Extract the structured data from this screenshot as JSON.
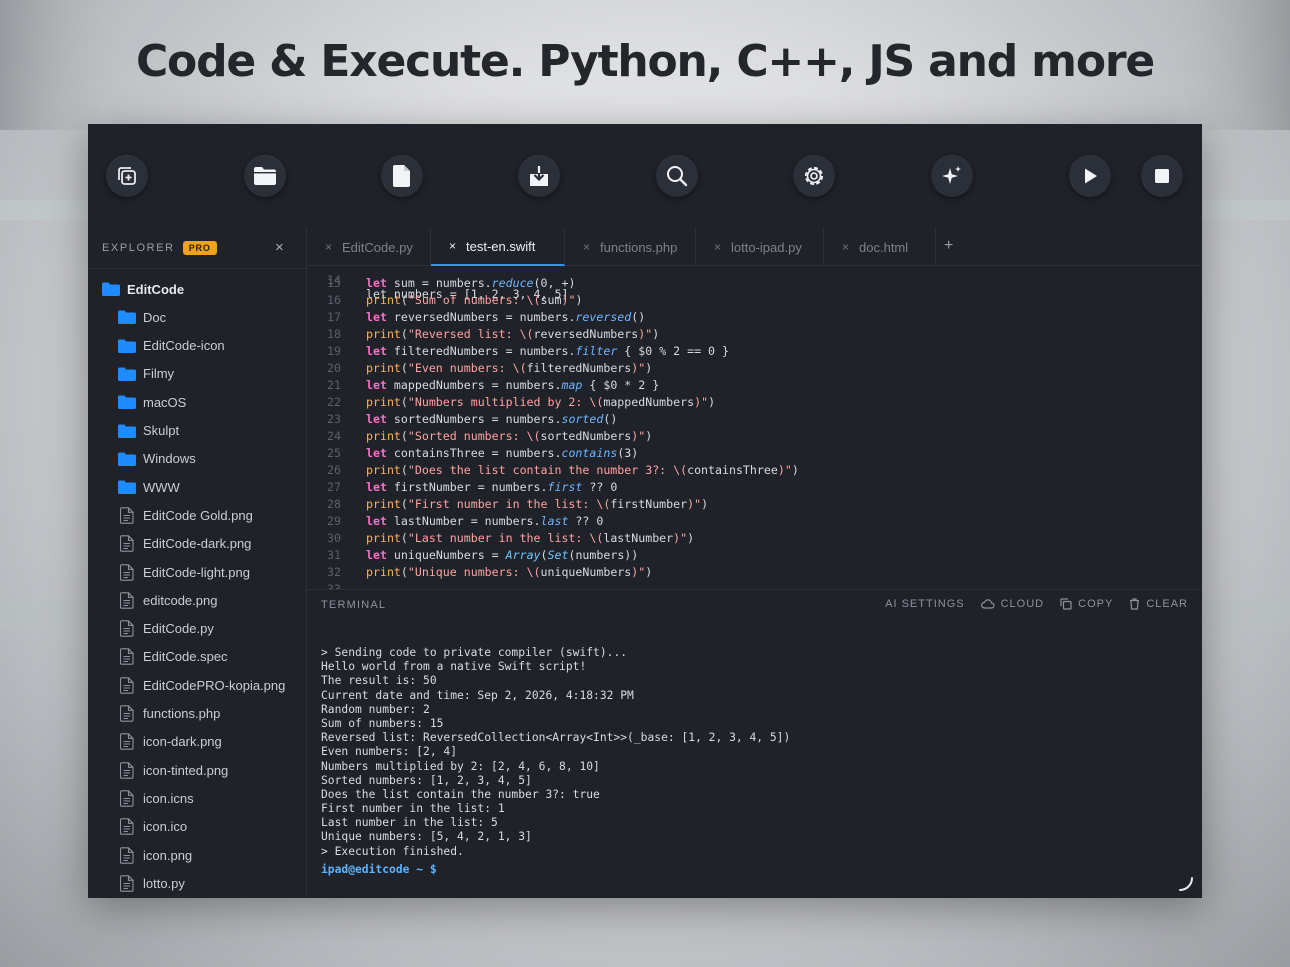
{
  "headline": "Code & Execute. Python, C++, JS and more",
  "toolbar": {
    "buttons": [
      {
        "name": "new-window-icon"
      },
      {
        "name": "folder-icon"
      },
      {
        "name": "new-file-icon"
      },
      {
        "name": "download-icon"
      },
      {
        "name": "search-icon"
      },
      {
        "name": "gear-icon"
      },
      {
        "name": "sparkles-icon"
      },
      {
        "name": "play-icon"
      },
      {
        "name": "stop-icon"
      }
    ]
  },
  "explorer": {
    "title": "EXPLORER",
    "badge": "PRO",
    "close": "×",
    "root": "EditCode",
    "folders": [
      "Doc",
      "EditCode-icon",
      "Filmy",
      "macOS",
      "Skulpt",
      "Windows",
      "WWW"
    ],
    "files": [
      "EditCode Gold.png",
      "EditCode-dark.png",
      "EditCode-light.png",
      "editcode.png",
      "EditCode.py",
      "EditCode.spec",
      "EditCodePRO-kopia.png",
      "functions.php",
      "icon-dark.png",
      "icon-tinted.png",
      "icon.icns",
      "icon.ico",
      "icon.png",
      "lotto.py"
    ]
  },
  "tabs": [
    {
      "label": "EditCode.py",
      "close": "×"
    },
    {
      "label": "test-en.swift",
      "close": "×",
      "active": true
    },
    {
      "label": "functions.php",
      "close": "×"
    },
    {
      "label": "lotto-ipad.py",
      "close": "×"
    },
    {
      "label": "doc.html",
      "close": "×"
    }
  ],
  "tab_add": "+",
  "editor": {
    "partial_top": "let numbers = [1, 2, 3, 4, 5]",
    "partial_bottom_number": "33",
    "lines": [
      {
        "n": "15",
        "code": "let sum = numbers.reduce(0, +)"
      },
      {
        "n": "16",
        "code": "print(\"Sum of numbers: \\(sum)\")"
      },
      {
        "n": "17",
        "code": "let reversedNumbers = numbers.reversed()"
      },
      {
        "n": "18",
        "code": "print(\"Reversed list: \\(reversedNumbers)\")"
      },
      {
        "n": "19",
        "code": "let filteredNumbers = numbers.filter { $0 % 2 == 0 }"
      },
      {
        "n": "20",
        "code": "print(\"Even numbers: \\(filteredNumbers)\")"
      },
      {
        "n": "21",
        "code": "let mappedNumbers = numbers.map { $0 * 2 }"
      },
      {
        "n": "22",
        "code": "print(\"Numbers multiplied by 2: \\(mappedNumbers)\")"
      },
      {
        "n": "23",
        "code": "let sortedNumbers = numbers.sorted()"
      },
      {
        "n": "24",
        "code": "print(\"Sorted numbers: \\(sortedNumbers)\")"
      },
      {
        "n": "25",
        "code": "let containsThree = numbers.contains(3)"
      },
      {
        "n": "26",
        "code": "print(\"Does the list contain the number 3?: \\(containsThree)\")"
      },
      {
        "n": "27",
        "code": "let firstNumber = numbers.first ?? 0"
      },
      {
        "n": "28",
        "code": "print(\"First number in the list: \\(firstNumber)\")"
      },
      {
        "n": "29",
        "code": "let lastNumber = numbers.last ?? 0"
      },
      {
        "n": "30",
        "code": "print(\"Last number in the list: \\(lastNumber)\")"
      },
      {
        "n": "31",
        "code": "let uniqueNumbers = Array(Set(numbers))"
      },
      {
        "n": "32",
        "code": "print(\"Unique numbers: \\(uniqueNumbers)\")"
      }
    ]
  },
  "terminal": {
    "title": "TERMINAL",
    "actions": {
      "ai_settings": "AI SETTINGS",
      "cloud": "CLOUD",
      "copy": "COPY",
      "clear": "CLEAR"
    },
    "output": [
      "> Sending code to private compiler (swift)...",
      "Hello world from a native Swift script!",
      "The result is: 50",
      "Current date and time: Sep 2, 2026, 4:18:32 PM",
      "Random number: 2",
      "Sum of numbers: 15",
      "Reversed list: ReversedCollection<Array<Int>>(_base: [1, 2, 3, 4, 5])",
      "Even numbers: [2, 4]",
      "Numbers multiplied by 2: [2, 4, 6, 8, 10]",
      "Sorted numbers: [1, 2, 3, 4, 5]",
      "Does the list contain the number 3?: true",
      "First number in the list: 1",
      "Last number in the list: 5",
      "Unique numbers: [5, 4, 2, 1, 3]",
      "> Execution finished."
    ],
    "prompt": "ipad@editcode ~ $"
  },
  "colors": {
    "window_bg": "#1f2229",
    "accent_blue": "#3d8ef0",
    "folder_blue": "#1e8cff",
    "pro_badge": "#f0a21a",
    "keyword": "#ff6ec7",
    "function": "#ffb05a",
    "string": "#ffa2a0",
    "method": "#6fb6ff"
  }
}
